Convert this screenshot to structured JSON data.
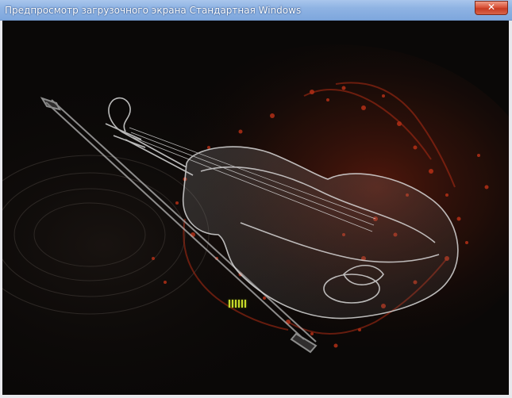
{
  "window": {
    "title": "Предпросмотр загрузочного экрана Стандартная Windows",
    "close_label": "✕"
  },
  "boot_screen": {
    "image_subject": "violin-and-bow",
    "loading_indicator": "progress-bars"
  },
  "colors": {
    "titlebar": "#8fb3e3",
    "close_button": "#d9533a",
    "background": "#0a0807",
    "accent_red": "#c83418",
    "progress": "#c6d92a"
  }
}
